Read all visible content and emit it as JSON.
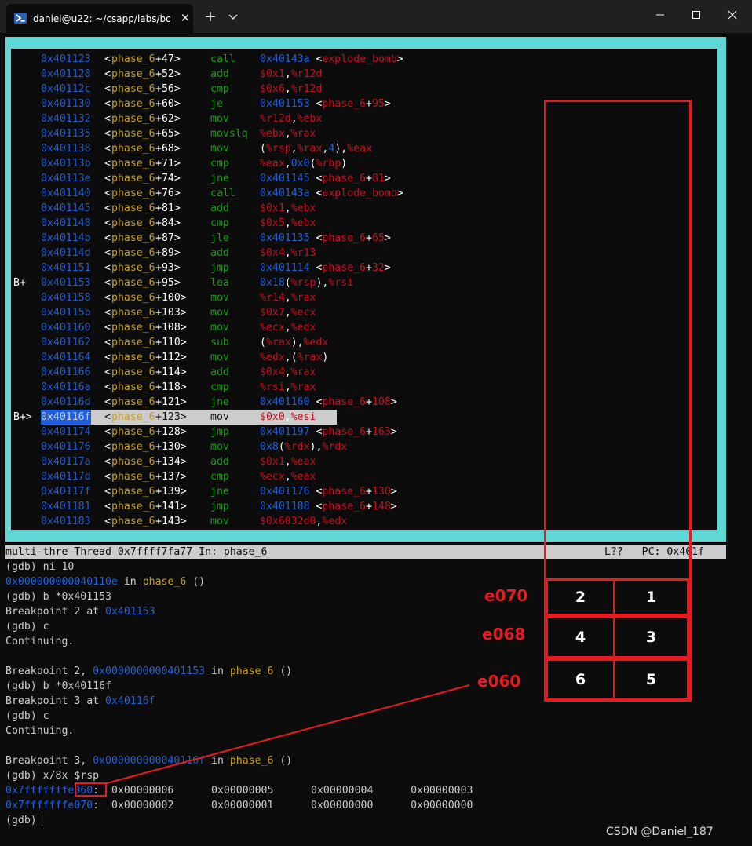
{
  "window": {
    "tab_title": "daniel@u22: ~/csapp/labs/bo",
    "tab_close": "✕",
    "new_tab": "+"
  },
  "asm": [
    {
      "mark": "",
      "addr": "0x401123",
      "fn": "phase_6",
      "off": "+47",
      "mnem": "call",
      "ops": [
        [
          "b",
          "0x40143a "
        ],
        [
          "w",
          "<"
        ],
        [
          "r",
          "explode_bomb"
        ],
        [
          "w",
          ">"
        ]
      ]
    },
    {
      "mark": "",
      "addr": "0x401128",
      "fn": "phase_6",
      "off": "+52",
      "mnem": "add",
      "ops": [
        [
          "r",
          "$0x1"
        ],
        [
          "w",
          ","
        ],
        [
          "r",
          "%r12d"
        ]
      ]
    },
    {
      "mark": "",
      "addr": "0x40112c",
      "fn": "phase_6",
      "off": "+56",
      "mnem": "cmp",
      "ops": [
        [
          "r",
          "$0x6"
        ],
        [
          "w",
          ","
        ],
        [
          "r",
          "%r12d"
        ]
      ]
    },
    {
      "mark": "",
      "addr": "0x401130",
      "fn": "phase_6",
      "off": "+60",
      "mnem": "je",
      "ops": [
        [
          "b",
          "0x401153 "
        ],
        [
          "w",
          "<"
        ],
        [
          "r",
          "phase_6"
        ],
        [
          "w",
          "+"
        ],
        [
          "r",
          "95"
        ],
        [
          "w",
          ">"
        ]
      ]
    },
    {
      "mark": "",
      "addr": "0x401132",
      "fn": "phase_6",
      "off": "+62",
      "mnem": "mov",
      "ops": [
        [
          "r",
          "%r12d"
        ],
        [
          "w",
          ","
        ],
        [
          "r",
          "%ebx"
        ]
      ]
    },
    {
      "mark": "",
      "addr": "0x401135",
      "fn": "phase_6",
      "off": "+65",
      "mnem": "movslq",
      "ops": [
        [
          "r",
          "%ebx"
        ],
        [
          "w",
          ","
        ],
        [
          "r",
          "%rax"
        ]
      ]
    },
    {
      "mark": "",
      "addr": "0x401138",
      "fn": "phase_6",
      "off": "+68",
      "mnem": "mov",
      "ops": [
        [
          "w",
          "("
        ],
        [
          "r",
          "%rsp"
        ],
        [
          "w",
          ","
        ],
        [
          "r",
          "%rax"
        ],
        [
          "w",
          ","
        ],
        [
          "b",
          "4"
        ],
        [
          "w",
          "),"
        ],
        [
          "r",
          "%eax"
        ]
      ]
    },
    {
      "mark": "",
      "addr": "0x40113b",
      "fn": "phase_6",
      "off": "+71",
      "mnem": "cmp",
      "ops": [
        [
          "r",
          "%eax"
        ],
        [
          "w",
          ","
        ],
        [
          "b",
          "0x0"
        ],
        [
          "w",
          "("
        ],
        [
          "r",
          "%rbp"
        ],
        [
          "w",
          ")"
        ]
      ]
    },
    {
      "mark": "",
      "addr": "0x40113e",
      "fn": "phase_6",
      "off": "+74",
      "mnem": "jne",
      "ops": [
        [
          "b",
          "0x401145 "
        ],
        [
          "w",
          "<"
        ],
        [
          "r",
          "phase_6"
        ],
        [
          "w",
          "+"
        ],
        [
          "r",
          "81"
        ],
        [
          "w",
          ">"
        ]
      ]
    },
    {
      "mark": "",
      "addr": "0x401140",
      "fn": "phase_6",
      "off": "+76",
      "mnem": "call",
      "ops": [
        [
          "b",
          "0x40143a "
        ],
        [
          "w",
          "<"
        ],
        [
          "r",
          "explode_bomb"
        ],
        [
          "w",
          ">"
        ]
      ]
    },
    {
      "mark": "",
      "addr": "0x401145",
      "fn": "phase_6",
      "off": "+81",
      "mnem": "add",
      "ops": [
        [
          "r",
          "$0x1"
        ],
        [
          "w",
          ","
        ],
        [
          "r",
          "%ebx"
        ]
      ]
    },
    {
      "mark": "",
      "addr": "0x401148",
      "fn": "phase_6",
      "off": "+84",
      "mnem": "cmp",
      "ops": [
        [
          "r",
          "$0x5"
        ],
        [
          "w",
          ","
        ],
        [
          "r",
          "%ebx"
        ]
      ]
    },
    {
      "mark": "",
      "addr": "0x40114b",
      "fn": "phase_6",
      "off": "+87",
      "mnem": "jle",
      "ops": [
        [
          "b",
          "0x401135 "
        ],
        [
          "w",
          "<"
        ],
        [
          "r",
          "phase_6"
        ],
        [
          "w",
          "+"
        ],
        [
          "r",
          "65"
        ],
        [
          "w",
          ">"
        ]
      ]
    },
    {
      "mark": "",
      "addr": "0x40114d",
      "fn": "phase_6",
      "off": "+89",
      "mnem": "add",
      "ops": [
        [
          "r",
          "$0x4"
        ],
        [
          "w",
          ","
        ],
        [
          "r",
          "%r13"
        ]
      ]
    },
    {
      "mark": "",
      "addr": "0x401151",
      "fn": "phase_6",
      "off": "+93",
      "mnem": "jmp",
      "ops": [
        [
          "b",
          "0x401114 "
        ],
        [
          "w",
          "<"
        ],
        [
          "r",
          "phase_6"
        ],
        [
          "w",
          "+"
        ],
        [
          "r",
          "32"
        ],
        [
          "w",
          ">"
        ]
      ]
    },
    {
      "mark": "B+",
      "addr": "0x401153",
      "fn": "phase_6",
      "off": "+95",
      "mnem": "lea",
      "ops": [
        [
          "b",
          "0x18"
        ],
        [
          "w",
          "("
        ],
        [
          "r",
          "%rsp"
        ],
        [
          "w",
          "),"
        ],
        [
          "r",
          "%rsi"
        ]
      ]
    },
    {
      "mark": "",
      "addr": "0x401158",
      "fn": "phase_6",
      "off": "+100",
      "mnem": "mov",
      "ops": [
        [
          "r",
          "%r14"
        ],
        [
          "w",
          ","
        ],
        [
          "r",
          "%rax"
        ]
      ]
    },
    {
      "mark": "",
      "addr": "0x40115b",
      "fn": "phase_6",
      "off": "+103",
      "mnem": "mov",
      "ops": [
        [
          "r",
          "$0x7"
        ],
        [
          "w",
          ","
        ],
        [
          "r",
          "%ecx"
        ]
      ]
    },
    {
      "mark": "",
      "addr": "0x401160",
      "fn": "phase_6",
      "off": "+108",
      "mnem": "mov",
      "ops": [
        [
          "r",
          "%ecx"
        ],
        [
          "w",
          ","
        ],
        [
          "r",
          "%edx"
        ]
      ]
    },
    {
      "mark": "",
      "addr": "0x401162",
      "fn": "phase_6",
      "off": "+110",
      "mnem": "sub",
      "ops": [
        [
          "w",
          "("
        ],
        [
          "r",
          "%rax"
        ],
        [
          "w",
          "),"
        ],
        [
          "r",
          "%edx"
        ]
      ]
    },
    {
      "mark": "",
      "addr": "0x401164",
      "fn": "phase_6",
      "off": "+112",
      "mnem": "mov",
      "ops": [
        [
          "r",
          "%edx"
        ],
        [
          "w",
          ",("
        ],
        [
          "r",
          "%rax"
        ],
        [
          "w",
          ")"
        ]
      ]
    },
    {
      "mark": "",
      "addr": "0x401166",
      "fn": "phase_6",
      "off": "+114",
      "mnem": "add",
      "ops": [
        [
          "r",
          "$0x4"
        ],
        [
          "w",
          ","
        ],
        [
          "r",
          "%rax"
        ]
      ]
    },
    {
      "mark": "",
      "addr": "0x40116a",
      "fn": "phase_6",
      "off": "+118",
      "mnem": "cmp",
      "ops": [
        [
          "r",
          "%rsi"
        ],
        [
          "w",
          ","
        ],
        [
          "r",
          "%rax"
        ]
      ]
    },
    {
      "mark": "",
      "addr": "0x40116d",
      "fn": "phase_6",
      "off": "+121",
      "mnem": "jne",
      "ops": [
        [
          "b",
          "0x401160 "
        ],
        [
          "w",
          "<"
        ],
        [
          "r",
          "phase_6"
        ],
        [
          "w",
          "+"
        ],
        [
          "r",
          "108"
        ],
        [
          "w",
          ">"
        ]
      ]
    },
    {
      "mark": "B+>",
      "addr": "0x40116f",
      "fn": "phase_6",
      "off": "+123",
      "mnem": "mov",
      "ops": [
        [
          "r",
          "$0x0"
        ],
        [
          "w",
          ","
        ],
        [
          "r",
          "%esi"
        ]
      ],
      "current": true
    },
    {
      "mark": "",
      "addr": "0x401174",
      "fn": "phase_6",
      "off": "+128",
      "mnem": "jmp",
      "ops": [
        [
          "b",
          "0x401197 "
        ],
        [
          "w",
          "<"
        ],
        [
          "r",
          "phase_6"
        ],
        [
          "w",
          "+"
        ],
        [
          "r",
          "163"
        ],
        [
          "w",
          ">"
        ]
      ]
    },
    {
      "mark": "",
      "addr": "0x401176",
      "fn": "phase_6",
      "off": "+130",
      "mnem": "mov",
      "ops": [
        [
          "b",
          "0x8"
        ],
        [
          "w",
          "("
        ],
        [
          "r",
          "%rdx"
        ],
        [
          "w",
          "),"
        ],
        [
          "r",
          "%rdx"
        ]
      ]
    },
    {
      "mark": "",
      "addr": "0x40117a",
      "fn": "phase_6",
      "off": "+134",
      "mnem": "add",
      "ops": [
        [
          "r",
          "$0x1"
        ],
        [
          "w",
          ","
        ],
        [
          "r",
          "%eax"
        ]
      ]
    },
    {
      "mark": "",
      "addr": "0x40117d",
      "fn": "phase_6",
      "off": "+137",
      "mnem": "cmp",
      "ops": [
        [
          "r",
          "%ecx"
        ],
        [
          "w",
          ","
        ],
        [
          "r",
          "%eax"
        ]
      ]
    },
    {
      "mark": "",
      "addr": "0x40117f",
      "fn": "phase_6",
      "off": "+139",
      "mnem": "jne",
      "ops": [
        [
          "b",
          "0x401176 "
        ],
        [
          "w",
          "<"
        ],
        [
          "r",
          "phase_6"
        ],
        [
          "w",
          "+"
        ],
        [
          "r",
          "130"
        ],
        [
          "w",
          ">"
        ]
      ]
    },
    {
      "mark": "",
      "addr": "0x401181",
      "fn": "phase_6",
      "off": "+141",
      "mnem": "jmp",
      "ops": [
        [
          "b",
          "0x401188 "
        ],
        [
          "w",
          "<"
        ],
        [
          "r",
          "phase_6"
        ],
        [
          "w",
          "+"
        ],
        [
          "r",
          "148"
        ],
        [
          "w",
          ">"
        ]
      ]
    },
    {
      "mark": "",
      "addr": "0x401183",
      "fn": "phase_6",
      "off": "+143",
      "mnem": "mov",
      "ops": [
        [
          "r",
          "$0x6032d0"
        ],
        [
          "w",
          ","
        ],
        [
          "r",
          "%edx"
        ]
      ]
    }
  ],
  "status": {
    "left": "multi-thre Thread 0x7ffff7fa77 In: phase_6",
    "right": "L??   PC: 0x401f"
  },
  "console": [
    [
      [
        "t",
        "(gdb) ni 10"
      ]
    ],
    [
      [
        "b",
        "0x000000000040110e"
      ],
      [
        "t",
        " in "
      ],
      [
        "y",
        "phase_6"
      ],
      [
        "t",
        " ()"
      ]
    ],
    [
      [
        "t",
        "(gdb) b *0x401153"
      ]
    ],
    [
      [
        "t",
        "Breakpoint 2 at "
      ],
      [
        "b",
        "0x401153"
      ]
    ],
    [
      [
        "t",
        "(gdb) c"
      ]
    ],
    [
      [
        "t",
        "Continuing."
      ]
    ],
    [
      [
        "t",
        ""
      ]
    ],
    [
      [
        "t",
        "Breakpoint 2, "
      ],
      [
        "b",
        "0x0000000000401153"
      ],
      [
        "t",
        " in "
      ],
      [
        "y",
        "phase_6"
      ],
      [
        "t",
        " ()"
      ]
    ],
    [
      [
        "t",
        "(gdb) b *0x40116f"
      ]
    ],
    [
      [
        "t",
        "Breakpoint 3 at "
      ],
      [
        "b",
        "0x40116f"
      ]
    ],
    [
      [
        "t",
        "(gdb) c"
      ]
    ],
    [
      [
        "t",
        "Continuing."
      ]
    ],
    [
      [
        "t",
        ""
      ]
    ],
    [
      [
        "t",
        "Breakpoint 3, "
      ],
      [
        "b",
        "0x000000000040116f"
      ],
      [
        "t",
        " in "
      ],
      [
        "y",
        "phase_6"
      ],
      [
        "t",
        " ()"
      ]
    ],
    [
      [
        "t",
        "(gdb) x/8x $rsp"
      ]
    ],
    [
      [
        "b",
        "0x7fffffffe060"
      ],
      [
        "t",
        ":  0x00000006      0x00000005      0x00000004      0x00000003"
      ]
    ],
    [
      [
        "b",
        "0x7fffffffe070"
      ],
      [
        "t",
        ":  0x00000002      0x00000001      0x00000000      0x00000000"
      ]
    ],
    [
      [
        "t",
        "(gdb)"
      ]
    ]
  ],
  "annotations": {
    "rows": [
      {
        "label": "e070",
        "left": "2",
        "right": "1"
      },
      {
        "label": "e068",
        "left": "4",
        "right": "3"
      },
      {
        "label": "e060",
        "left": "6",
        "right": "5"
      }
    ],
    "accent_color": "#e51b24"
  },
  "watermark": "CSDN @Daniel_187"
}
